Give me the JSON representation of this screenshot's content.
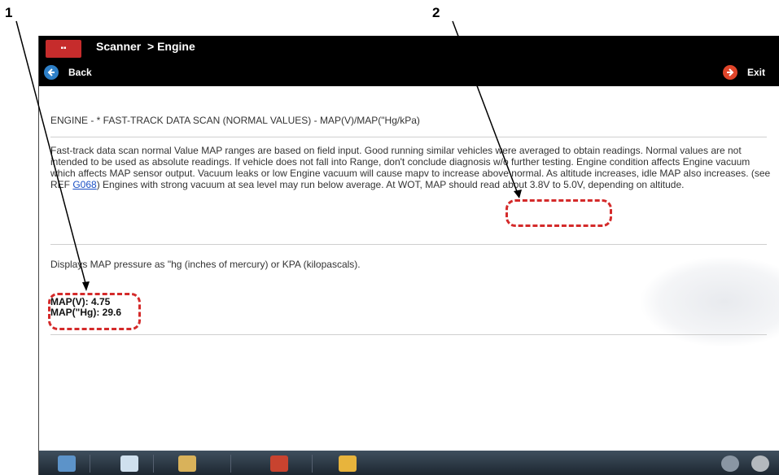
{
  "callouts": [
    "1",
    "2"
  ],
  "titlebar": {
    "title": "Scanner  > Engine"
  },
  "nav": {
    "back_label": "Back",
    "exit_label": "Exit"
  },
  "content": {
    "heading": "ENGINE - * FAST-TRACK DATA SCAN (NORMAL VALUES) - MAP(V)/MAP(\"Hg/kPa)",
    "paragraph_before_ref": "Fast-track data scan normal Value MAP ranges are based on field input. Good running similar vehicles were averaged to obtain readings. Normal values are not intended to be used as absolute readings. If vehicle does not fall into Range, don't conclude diagnosis w/o further testing. Engine condition affects Engine vacuum which affects MAP sensor output. Vacuum leaks or low Engine vacuum will cause mapv to increase above normal. As altitude increases, idle MAP also increases. (see REF ",
    "ref_link": "G068",
    "paragraph_after_ref": ") Engines with strong vacuum at sea level may run below average. At WOT, MAP should read about 3.8V to 5.0V, depending on altitude.",
    "description": "Displays MAP pressure as \"hg (inches of mercury) or KPA (kilopascals).",
    "value1": "MAP(V): 4.75",
    "value2": "MAP(\"Hg): 29.6"
  },
  "icons": {
    "app_logo": "scanner-logo-icon",
    "back": "back-arrow-icon",
    "exit": "exit-arrow-icon",
    "taskbar": [
      "home-icon",
      "document-icon",
      "tools-icon",
      "vehicle-icon",
      "folder-icon",
      "wireless-icon",
      "connection-icon"
    ]
  },
  "colors": {
    "titlebar": "#000000",
    "callout_dash": "#d42a2a",
    "link": "#1a4fc4",
    "back_icon": "#2e80c8",
    "exit_icon": "#e0452a"
  }
}
